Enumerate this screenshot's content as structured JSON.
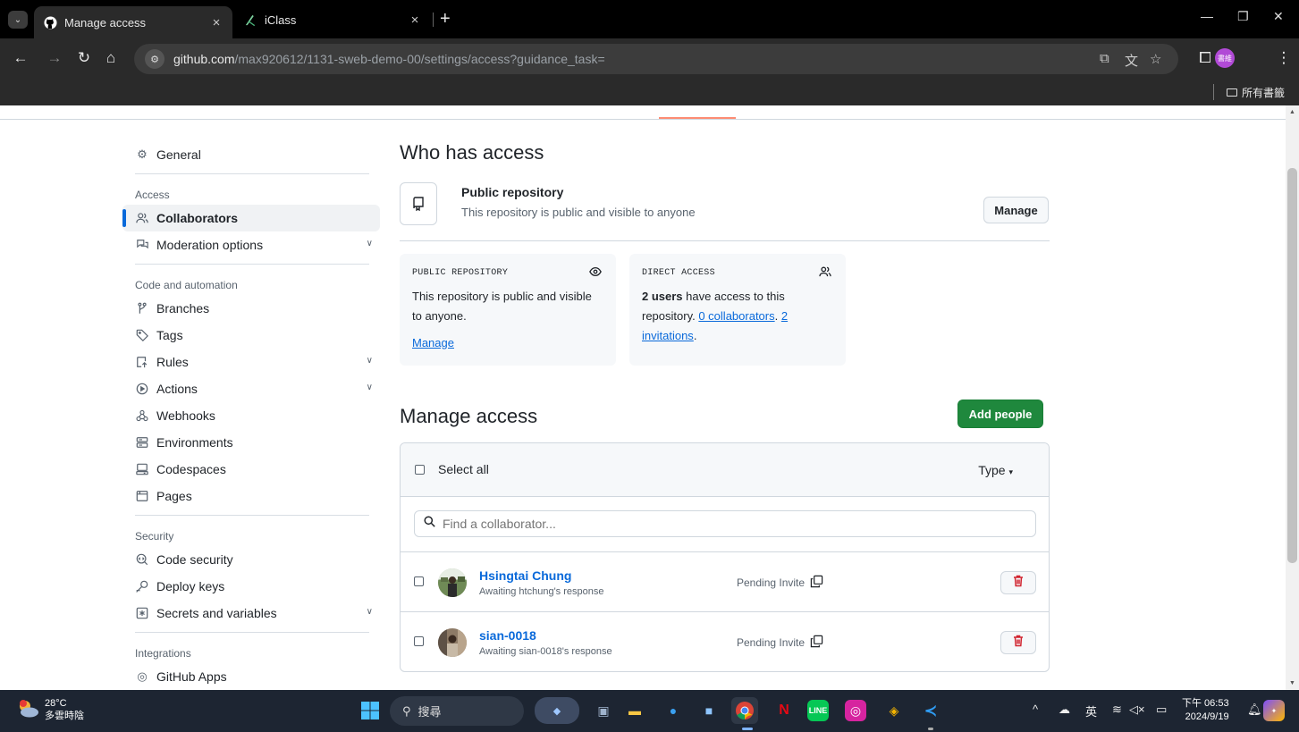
{
  "browser": {
    "tabs": [
      {
        "title": "Manage access",
        "close": "×"
      },
      {
        "title": "iClass",
        "close": "×"
      }
    ],
    "new_tab": "+",
    "url_host": "github.com",
    "url_path": "/max920612/1131-sweb-demo-00/settings/access?guidance_task=",
    "profile_label": "書維",
    "bookmarks_all": "所有書籤"
  },
  "sidebar": {
    "general": "General",
    "access_heading": "Access",
    "collaborators": "Collaborators",
    "moderation": "Moderation options",
    "code_heading": "Code and automation",
    "branches": "Branches",
    "tags": "Tags",
    "rules": "Rules",
    "actions": "Actions",
    "webhooks": "Webhooks",
    "environments": "Environments",
    "codespaces": "Codespaces",
    "pages": "Pages",
    "security_heading": "Security",
    "code_security": "Code security",
    "deploy_keys": "Deploy keys",
    "secrets": "Secrets and variables",
    "integrations_heading": "Integrations",
    "github_apps": "GitHub Apps"
  },
  "main": {
    "who_has_access": "Who has access",
    "public_title": "Public repository",
    "public_desc": "This repository is public and visible to anyone",
    "manage_btn": "Manage",
    "card_public": {
      "title": "PUBLIC REPOSITORY",
      "text": "This repository is public and visible to anyone.",
      "link": "Manage"
    },
    "card_direct": {
      "title": "DIRECT ACCESS",
      "users_bold": "2 users",
      "text_a": " have access to this repository. ",
      "collab_link": "0 collaborators",
      "sep": ". ",
      "inv_link": "2 invitations",
      "end": "."
    },
    "manage_access": "Manage access",
    "add_people": "Add people",
    "select_all": "Select all",
    "type_label": "Type",
    "search_placeholder": "Find a collaborator...",
    "rows": [
      {
        "name": "Hsingtai Chung",
        "sub": "Awaiting htchung's response",
        "status": "Pending Invite"
      },
      {
        "name": "sian-0018",
        "sub": "Awaiting sian-0018's response",
        "status": "Pending Invite"
      }
    ]
  },
  "taskbar": {
    "temp": "28°C",
    "weather": "多雲時陰",
    "search": "搜尋",
    "ime": "英",
    "time": "下午 06:53",
    "date": "2024/9/19"
  }
}
